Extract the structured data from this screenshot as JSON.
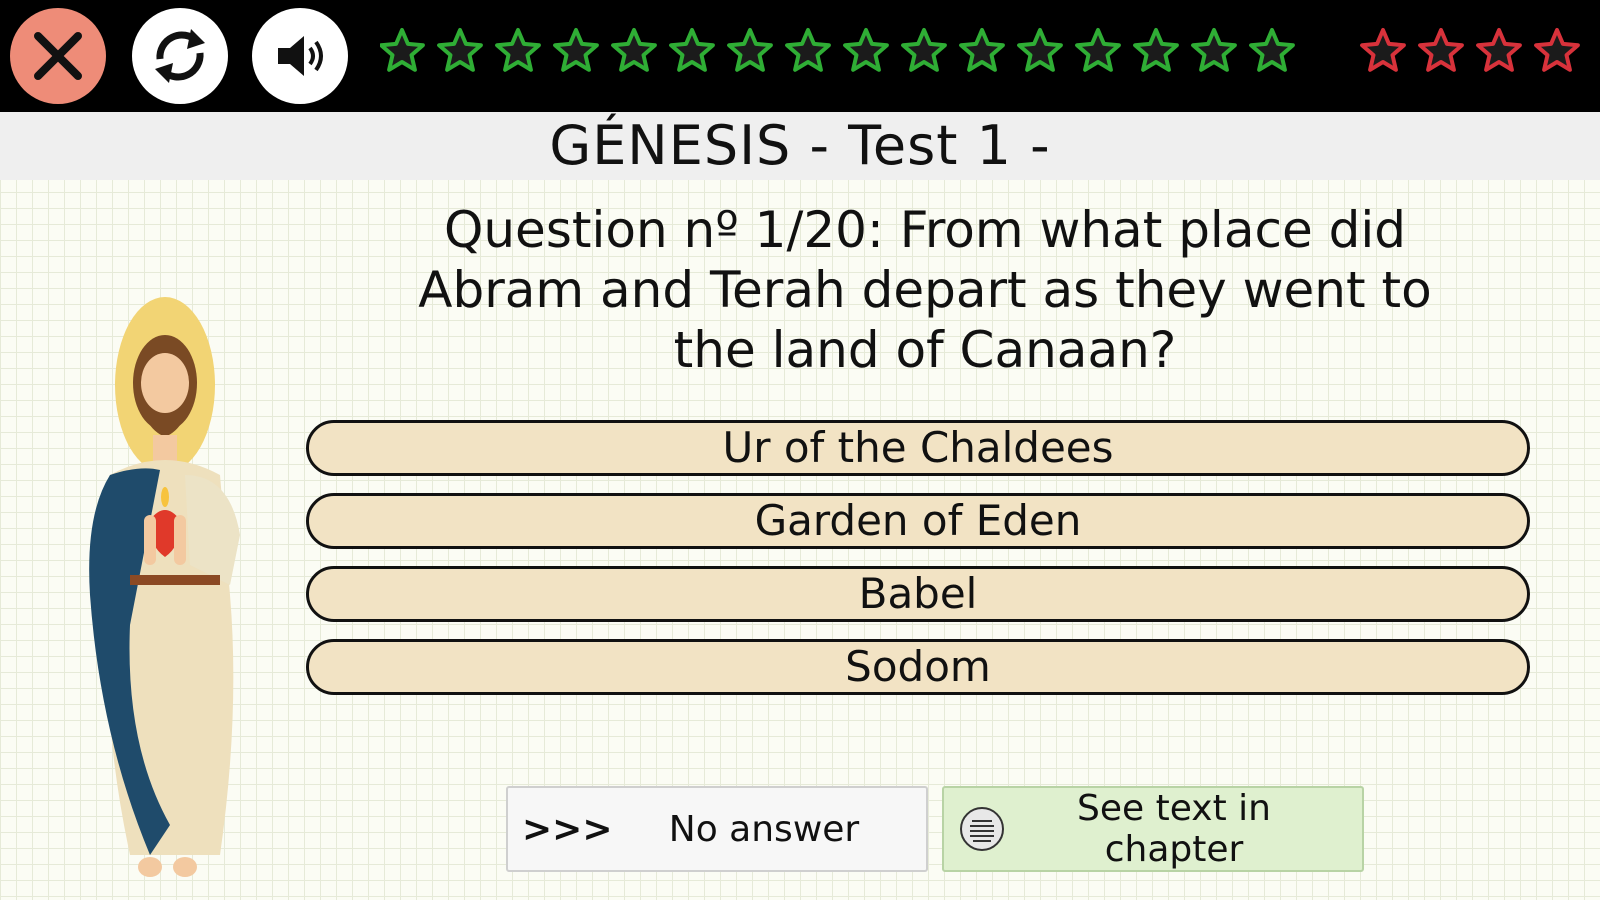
{
  "topbar": {
    "close_icon": "close-icon",
    "reload_icon": "refresh-icon",
    "sound_icon": "speaker-icon",
    "green_stars_count": 16,
    "red_stars_count": 4,
    "green_star_color": "#2fae35",
    "red_star_color": "#d8323b"
  },
  "title": "GÉNESIS - Test 1 -",
  "question": {
    "text": "Question nº 1/20: From what place did Abram and Terah depart as they went to the land of Canaan?"
  },
  "answers": [
    {
      "label": "Ur of the Chaldees"
    },
    {
      "label": "Garden of Eden"
    },
    {
      "label": "Babel"
    },
    {
      "label": "Sodom"
    }
  ],
  "buttons": {
    "no_answer_arrows": ">>>",
    "no_answer_label": "No answer",
    "see_text_label": "See text in chapter",
    "see_text_icon": "chapter-text-icon"
  },
  "colors": {
    "answer_fill": "#f2e3c4",
    "close_button": "#ee8c78",
    "see_text_fill": "#dff0cf"
  }
}
